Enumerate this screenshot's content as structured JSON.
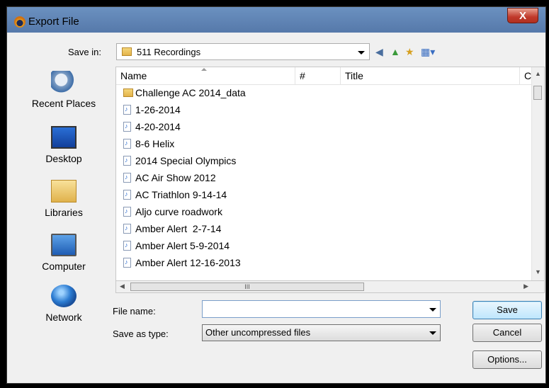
{
  "window": {
    "title": "Export File",
    "close_label": "X"
  },
  "save_in": {
    "label": "Save in:",
    "value": "511 Recordings"
  },
  "toolbar_icons": [
    "back-icon",
    "up-folder-icon",
    "new-folder-icon",
    "view-menu-icon"
  ],
  "places": [
    {
      "label": "Recent Places",
      "icon": "recent-places-icon"
    },
    {
      "label": "Desktop",
      "icon": "desktop-icon"
    },
    {
      "label": "Libraries",
      "icon": "libraries-icon"
    },
    {
      "label": "Computer",
      "icon": "computer-icon"
    },
    {
      "label": "Network",
      "icon": "network-icon"
    }
  ],
  "columns": [
    "Name",
    "#",
    "Title",
    "Co"
  ],
  "files": [
    {
      "name": "Challenge AC 2014_data",
      "type": "folder"
    },
    {
      "name": "1-26-2014",
      "type": "audio"
    },
    {
      "name": "4-20-2014",
      "type": "audio"
    },
    {
      "name": "8-6 Helix",
      "type": "audio"
    },
    {
      "name": "2014 Special Olympics",
      "type": "audio"
    },
    {
      "name": "AC Air Show 2012",
      "type": "audio"
    },
    {
      "name": "AC Triathlon 9-14-14",
      "type": "audio"
    },
    {
      "name": "Aljo curve roadwork",
      "type": "audio"
    },
    {
      "name": "Amber Alert  2-7-14",
      "type": "audio"
    },
    {
      "name": "Amber Alert 5-9-2014",
      "type": "audio"
    },
    {
      "name": "Amber Alert 12-16-2013",
      "type": "audio"
    }
  ],
  "file_name": {
    "label": "File name:",
    "value": ""
  },
  "save_as_type": {
    "label": "Save as type:",
    "value": "Other uncompressed files"
  },
  "buttons": {
    "save": "Save",
    "cancel": "Cancel",
    "options": "Options..."
  },
  "hscroll_grip": "III"
}
